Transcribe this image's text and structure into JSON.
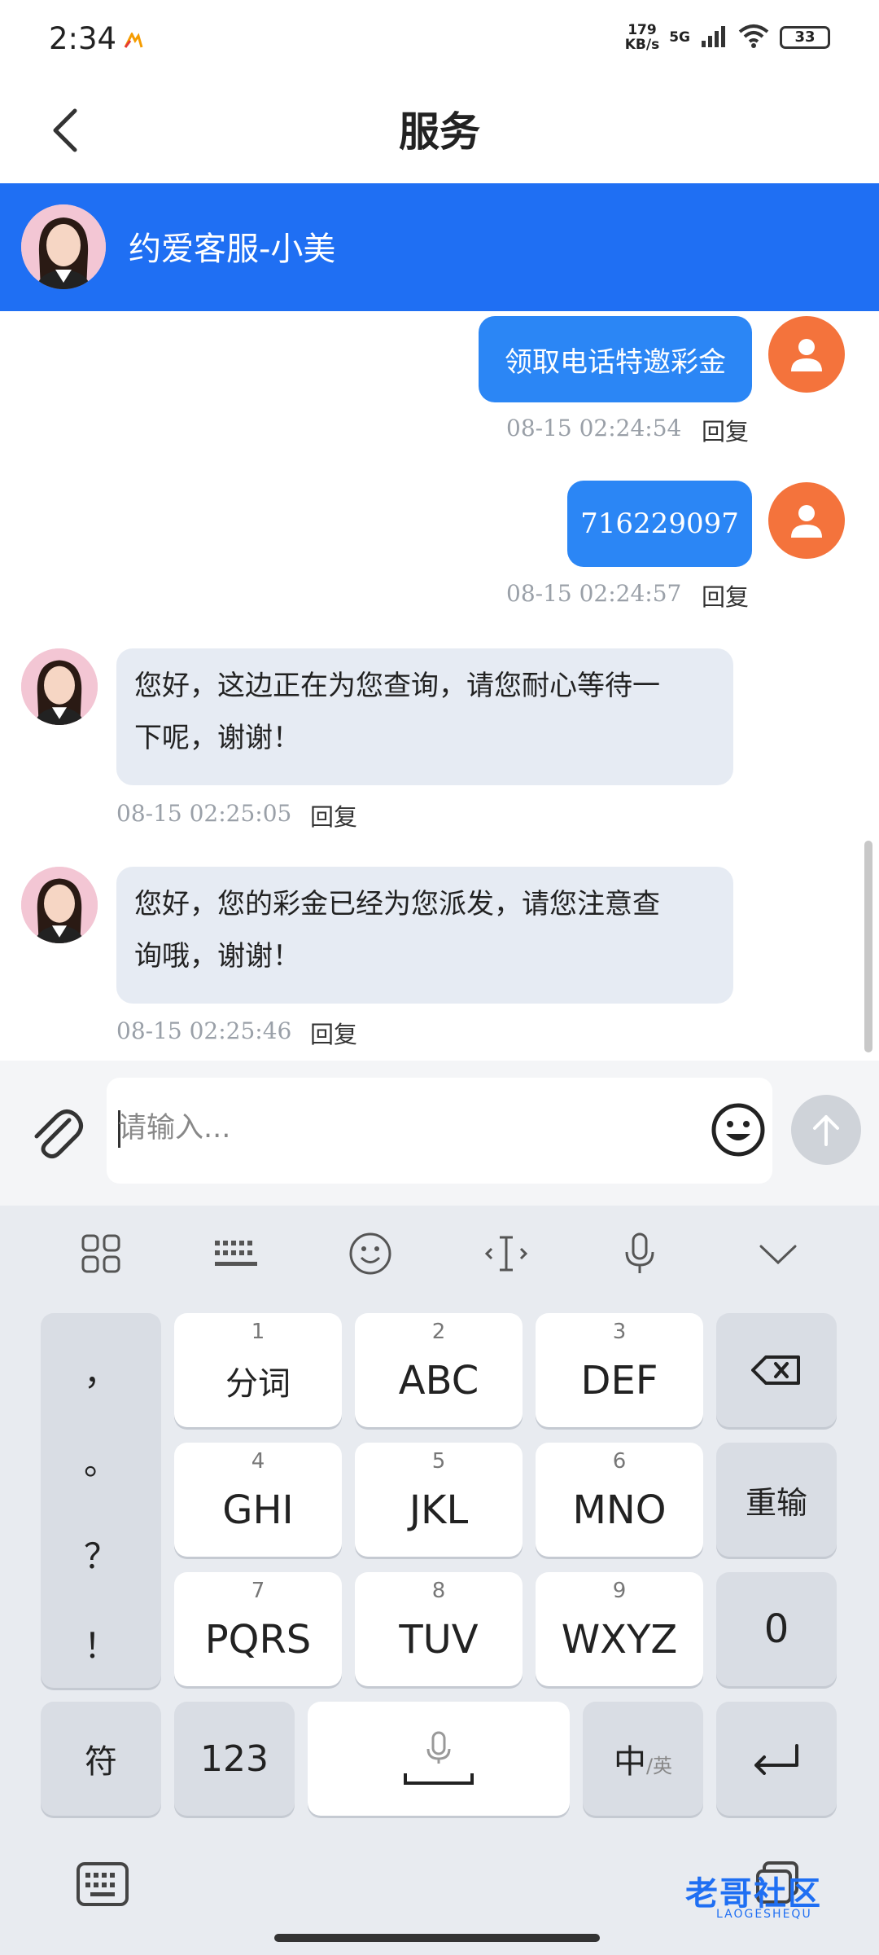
{
  "status_bar": {
    "time": "2:34",
    "speed_value": "179",
    "speed_unit": "KB/s",
    "network": "5G",
    "battery": "33"
  },
  "header": {
    "title": "服务"
  },
  "agent": {
    "name": "约爱客服-小美"
  },
  "messages": [
    {
      "side": "out",
      "text": "领取电话特邀彩金",
      "time": "08-15 02:24:54",
      "reply": "回复"
    },
    {
      "side": "out",
      "text": "716229097",
      "time": "08-15 02:24:57",
      "reply": "回复"
    },
    {
      "side": "in",
      "line1": "您好，这边正在为您查询，请您耐心等待一",
      "line2": "下呢，谢谢！",
      "time": "08-15 02:25:05",
      "reply": "回复"
    },
    {
      "side": "in",
      "line1": "您好，您的彩金已经为您派发，请您注意查",
      "line2": "询哦，谢谢！",
      "time": "08-15 02:25:46",
      "reply": "回复"
    }
  ],
  "input": {
    "placeholder": "请输入..."
  },
  "keyboard": {
    "punctuation": [
      "，",
      "。",
      "？",
      "！"
    ],
    "keys": [
      {
        "num": "1",
        "label": "分词"
      },
      {
        "num": "2",
        "label": "ABC"
      },
      {
        "num": "3",
        "label": "DEF"
      },
      {
        "num": "4",
        "label": "GHI"
      },
      {
        "num": "5",
        "label": "JKL"
      },
      {
        "num": "6",
        "label": "MNO"
      },
      {
        "num": "7",
        "label": "PQRS"
      },
      {
        "num": "8",
        "label": "TUV"
      },
      {
        "num": "9",
        "label": "WXYZ"
      }
    ],
    "reinput": "重输",
    "zero": "0",
    "symbols": "符",
    "numbers": "123",
    "lang_main": "中",
    "lang_alt": "/英"
  },
  "watermark": {
    "text": "老哥社区",
    "sub": "LAOGESHEQU"
  }
}
